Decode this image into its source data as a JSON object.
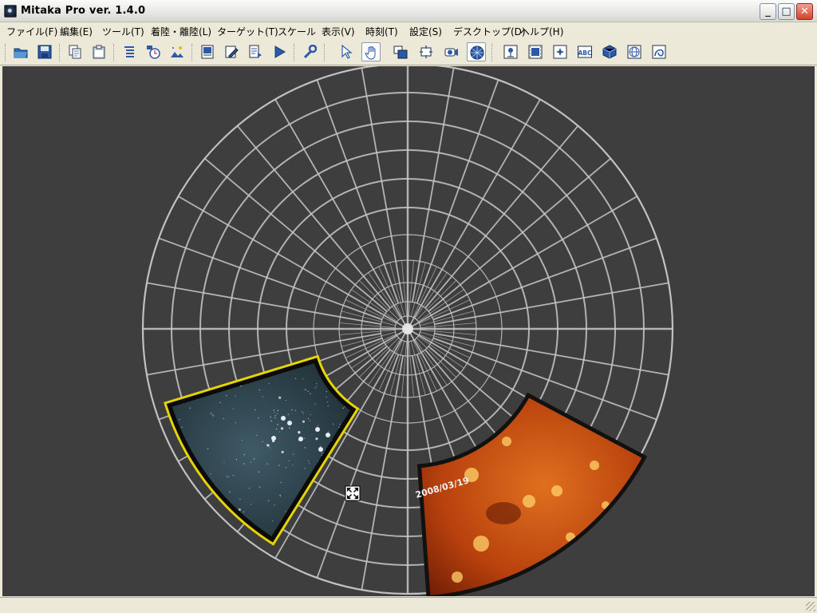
{
  "window": {
    "title": "Mitaka Pro ver. 1.4.0",
    "controls": [
      "minimize",
      "maximize",
      "close"
    ],
    "minimize_glyph": "_",
    "maximize_glyph": "□",
    "close_glyph": "✕"
  },
  "menu": {
    "items": [
      {
        "label": "ファイル(F)"
      },
      {
        "label": "編集(E)"
      },
      {
        "label": "ツール(T)"
      },
      {
        "label": "着陸・離陸(L)"
      },
      {
        "label": "ターゲット(T)"
      },
      {
        "label": "スケール"
      },
      {
        "label": "表示(V)"
      },
      {
        "label": "時刻(T)"
      },
      {
        "label": "設定(S)"
      },
      {
        "label": "デスクトップ(D)"
      },
      {
        "label": "ヘルプ(H)"
      }
    ]
  },
  "toolbar": {
    "buttons": [
      {
        "name": "open-folder-icon"
      },
      {
        "name": "save-disk-icon"
      },
      {
        "name": "copy-document-icon"
      },
      {
        "name": "clipboard-icon"
      },
      {
        "name": "layer-list-icon"
      },
      {
        "name": "clock-settings-icon"
      },
      {
        "name": "landscape-image-icon"
      },
      {
        "name": "page-icon"
      },
      {
        "name": "edit-pencil-icon"
      },
      {
        "name": "document-arrow-icon"
      },
      {
        "name": "play-icon"
      },
      {
        "name": "wrench-icon"
      },
      {
        "name": "cursor-arrow-icon"
      },
      {
        "name": "hand-pan-icon",
        "pressed": true
      },
      {
        "name": "window-layout-icon"
      },
      {
        "name": "window-resize-icon"
      },
      {
        "name": "projector-icon"
      },
      {
        "name": "dome-view-icon",
        "pressed": true
      },
      {
        "name": "pin-image-icon"
      },
      {
        "name": "film-frame-icon"
      },
      {
        "name": "starfield-icon"
      },
      {
        "name": "text-abc-icon",
        "text": "ABC"
      },
      {
        "name": "cube-icon"
      },
      {
        "name": "globe-grid-icon"
      },
      {
        "name": "curve-tool-icon"
      }
    ]
  },
  "viewport": {
    "background_color": "#3e3e3e",
    "grid_color": "#c8c8c8",
    "selection_color": "#e6d400",
    "images": [
      {
        "name": "pleiades-star-cluster-image",
        "selected": true
      },
      {
        "name": "sun-xray-image",
        "caption": "2008/03/19"
      }
    ],
    "cursor": "move-cursor-icon"
  }
}
